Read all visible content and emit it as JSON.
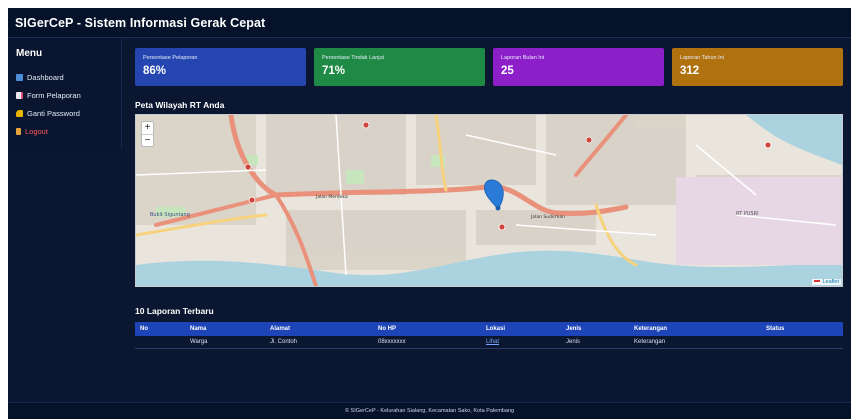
{
  "app": {
    "title": "SIGerCeP - Sistem Informasi Gerak Cepat"
  },
  "sidebar": {
    "title": "Menu",
    "items": [
      {
        "label": "Dashboard",
        "icon": "chart-icon",
        "color": "#4a8fd8"
      },
      {
        "label": "Form Pelaporan",
        "icon": "document-icon",
        "color": "#e8e8f0"
      },
      {
        "label": "Ganti Password",
        "icon": "key-icon",
        "color": "#e8b400"
      },
      {
        "label": "Logout",
        "icon": "door-icon",
        "color": "#e8a23a"
      }
    ]
  },
  "cards": [
    {
      "label": "Persentase Pelaporan",
      "value": "86%",
      "color": "#2546b0"
    },
    {
      "label": "Persentase Tindak Lanjut",
      "value": "71%",
      "color": "#1f8a45"
    },
    {
      "label": "Laporan Bulan Ini",
      "value": "25",
      "color": "#8c1fc7"
    },
    {
      "label": "Laporan Tahun Ini",
      "value": "312",
      "color": "#b0710f"
    }
  ],
  "map": {
    "title": "Peta Wilayah RT Anda",
    "zoom_in": "+",
    "zoom_out": "−",
    "attribution": "Leaflet",
    "labels": {
      "rt_pusri": "RT PUSRI",
      "bukit_siguntang": "Bukit Siguntang",
      "jalan_merdeka": "Jalan Merdeka",
      "jalan_sudirman": "Jalan Sudirman"
    }
  },
  "reports": {
    "title": "10 Laporan Terbaru",
    "columns": [
      "No",
      "Nama",
      "Alamat",
      "No HP",
      "Lokasi",
      "Jenis",
      "Keterangan",
      "Status"
    ],
    "rows": [
      {
        "no": "",
        "nama": "Warga",
        "alamat": "Jl. Contoh",
        "hp": "08xxxxxxx",
        "lokasi": "Lihat",
        "jenis": "Jenis",
        "keterangan": "Keterangan",
        "status": ""
      }
    ]
  },
  "footer": {
    "text": "© SIGerCeP - Kelurahan Sialang, Kecamatan Sako, Kota Palembang"
  }
}
